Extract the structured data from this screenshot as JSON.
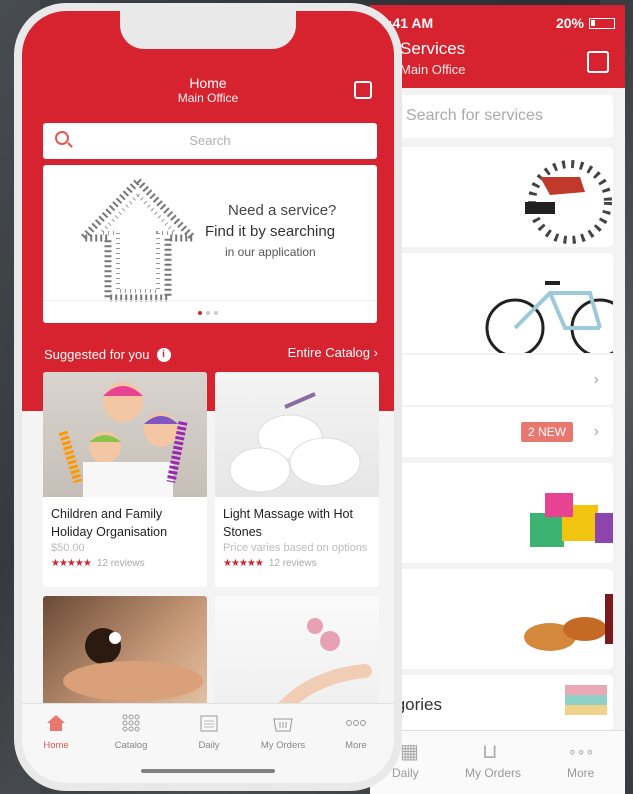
{
  "colors": {
    "brand": "#d6232f",
    "accent": "#e0584f"
  },
  "back_phone": {
    "time": "9:41 AM",
    "battery": "20%",
    "title": "Services",
    "subtitle": "Main Office",
    "search_placeholder": "Search for services",
    "badge": "2 NEW",
    "section_label": "Categories",
    "tabs": [
      {
        "label": "Daily",
        "icon": "calendar-icon"
      },
      {
        "label": "My Orders",
        "icon": "basket-icon"
      },
      {
        "label": "More",
        "icon": "more-icon"
      }
    ]
  },
  "header": {
    "title": "Home",
    "subtitle": "Main Office",
    "icon": "contacts-icon"
  },
  "search": {
    "placeholder": "Search"
  },
  "banner": {
    "line1": "Need a service?",
    "line2": "Find it by searching",
    "line3": "in our application",
    "page_count": 3,
    "active_page": 1
  },
  "suggested": {
    "label": "Suggested for you",
    "catalog_link": "Entire Catalog"
  },
  "cards": [
    {
      "title": "Children and Family Holiday Organisation",
      "price": "$50.00",
      "stars": "★★★★★",
      "reviews": "12 reviews"
    },
    {
      "title": "Light Massage with Hot Stones",
      "price": "Price varies based on options",
      "stars": "★★★★★",
      "reviews": "12 reviews"
    }
  ],
  "tabs": [
    {
      "label": "Home",
      "icon": "home-icon"
    },
    {
      "label": "Catalog",
      "icon": "grid-icon"
    },
    {
      "label": "Daily",
      "icon": "calendar-icon"
    },
    {
      "label": "My Orders",
      "icon": "basket-icon"
    },
    {
      "label": "More",
      "icon": "more-icon"
    }
  ]
}
